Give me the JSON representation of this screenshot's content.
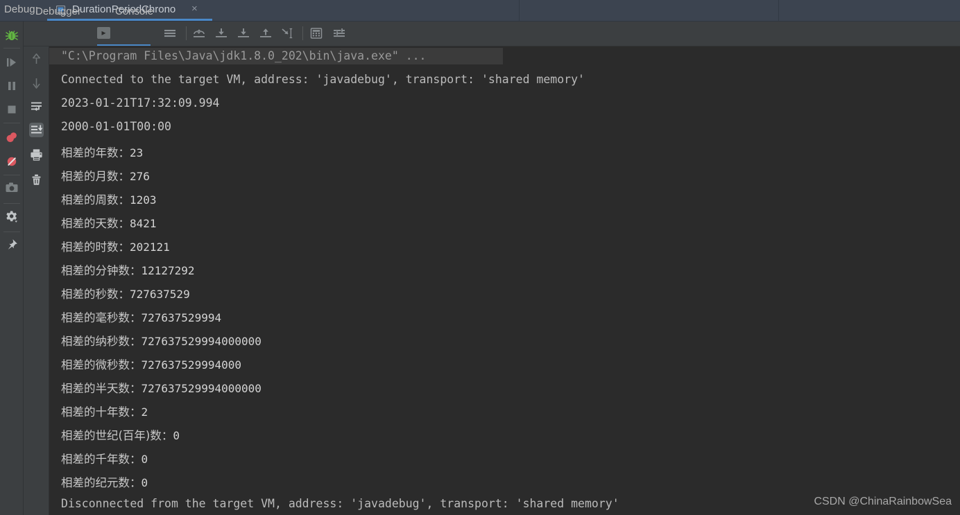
{
  "window": {
    "debug_label": "Debug:",
    "tab_title": "DurationPeriodChrono",
    "close_glyph": "×"
  },
  "toolbar": {
    "tabs": [
      {
        "label": "Debugger",
        "selected": false
      },
      {
        "label": "Console",
        "selected": true
      }
    ],
    "console_icon_glyph": "▸",
    "icons": [
      {
        "name": "soft-wrap-icon"
      },
      {
        "name": "step-over-icon"
      },
      {
        "name": "step-into-icon"
      },
      {
        "name": "force-step-into-icon"
      },
      {
        "name": "step-out-icon"
      },
      {
        "name": "run-to-cursor-icon"
      },
      {
        "name": "evaluate-expression-icon"
      },
      {
        "name": "settings-filter-icon"
      }
    ]
  },
  "left_strip": {
    "icons": [
      {
        "name": "debug-bug-icon"
      },
      {
        "name": "resume-program-icon"
      },
      {
        "name": "pause-program-icon"
      },
      {
        "name": "stop-program-icon"
      },
      {
        "name": "view-breakpoints-icon"
      },
      {
        "name": "mute-breakpoints-icon"
      },
      {
        "name": "camera-snapshot-icon"
      },
      {
        "name": "settings-gear-icon"
      },
      {
        "name": "pin-tab-icon"
      }
    ]
  },
  "console_strip": {
    "icons": [
      {
        "name": "scroll-up-icon"
      },
      {
        "name": "scroll-down-icon"
      },
      {
        "name": "soft-wrap-lines-icon"
      },
      {
        "name": "scroll-to-end-icon",
        "selected": true
      },
      {
        "name": "print-icon"
      },
      {
        "name": "clear-all-icon"
      }
    ]
  },
  "console": {
    "lines": [
      {
        "kind": "cmd",
        "text": "\"C:\\Program Files\\Java\\jdk1.8.0_202\\bin\\java.exe\" ..."
      },
      {
        "kind": "sys",
        "text": "Connected to the target VM, address: 'javadebug', transport: 'shared memory'"
      },
      {
        "kind": "out",
        "text": "2023-01-21T17:32:09.994"
      },
      {
        "kind": "out",
        "text": "2000-01-01T00:00"
      },
      {
        "kind": "cjk",
        "label": "相差的年数：",
        "value": "23"
      },
      {
        "kind": "cjk",
        "label": "相差的月数：",
        "value": "276"
      },
      {
        "kind": "cjk",
        "label": "相差的周数：",
        "value": "1203"
      },
      {
        "kind": "cjk",
        "label": "相差的天数：",
        "value": "8421"
      },
      {
        "kind": "cjk",
        "label": "相差的时数：",
        "value": "202121"
      },
      {
        "kind": "cjk",
        "label": "相差的分钟数：",
        "value": "12127292"
      },
      {
        "kind": "cjk",
        "label": "相差的秒数：",
        "value": "727637529"
      },
      {
        "kind": "cjk",
        "label": "相差的毫秒数：",
        "value": "727637529994"
      },
      {
        "kind": "cjk",
        "label": "相差的纳秒数：",
        "value": "727637529994000000"
      },
      {
        "kind": "cjk",
        "label": "相差的微秒数：",
        "value": "727637529994000"
      },
      {
        "kind": "cjk",
        "label": "相差的半天数：",
        "value": "727637529994000000"
      },
      {
        "kind": "cjk",
        "label": "相差的十年数：",
        "value": "2"
      },
      {
        "kind": "cjk",
        "label": "相差的世纪(百年)数：",
        "value": "0"
      },
      {
        "kind": "cjk",
        "label": "相差的千年数：",
        "value": "0"
      },
      {
        "kind": "cjk",
        "label": "相差的纪元数：",
        "value": "0"
      },
      {
        "kind": "sys",
        "text": "Disconnected from the target VM, address: 'javadebug', transport: 'shared memory'"
      }
    ]
  },
  "watermark": "CSDN @ChinaRainbowSea",
  "colors": {
    "topbar_bg": "#3c4450",
    "panel_bg": "#3c3f41",
    "console_bg": "#2b2b2b",
    "accent_blue": "#4a88c7",
    "text_primary": "#bbbbbb",
    "breakpoint_red": "#db5860",
    "bug_green": "#62b543"
  }
}
